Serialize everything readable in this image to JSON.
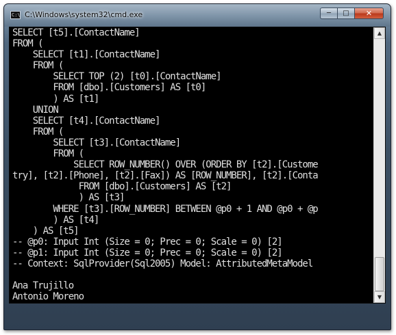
{
  "window": {
    "title": "C:\\Windows\\system32\\cmd.exe",
    "icon": "console-icon",
    "icon_glyph": "C:\\",
    "controls": {
      "minimize_glyph": "─",
      "maximize_glyph": "□",
      "close_glyph": "✕"
    }
  },
  "console": {
    "lines": [
      "SELECT [t5].[ContactName]",
      "FROM (",
      "    SELECT [t1].[ContactName]",
      "    FROM (",
      "        SELECT TOP (2) [t0].[ContactName]",
      "        FROM [dbo].[Customers] AS [t0]",
      "        ) AS [t1]",
      "    UNION",
      "    SELECT [t4].[ContactName]",
      "    FROM (",
      "        SELECT [t3].[ContactName]",
      "        FROM (",
      "            SELECT ROW_NUMBER() OVER (ORDER BY [t2].[Custome",
      "try], [t2].[Phone], [t2].[Fax]) AS [ROW_NUMBER], [t2].[Conta",
      "             FROM [dbo].[Customers] AS [t2]",
      "             ) AS [t3]",
      "        WHERE [t3].[ROW_NUMBER] BETWEEN @p0 + 1 AND @p0 + @p",
      "        ) AS [t4]",
      "    ) AS [t5]",
      "-- @p0: Input Int (Size = 0; Prec = 0; Scale = 0) [2]",
      "-- @p1: Input Int (Size = 0; Prec = 0; Scale = 0) [2]",
      "-- Context: SqlProvider(Sql2005) Model: AttributedMetaModel",
      "",
      "Ana Trujillo",
      "Antonio Moreno"
    ]
  },
  "scrollbar": {
    "up_glyph": "▲",
    "down_glyph": "▼",
    "position_fraction": 1.0
  },
  "colors": {
    "console_bg": "#000000",
    "console_fg": "#e0e0e0",
    "close_button": "#c0462a"
  }
}
